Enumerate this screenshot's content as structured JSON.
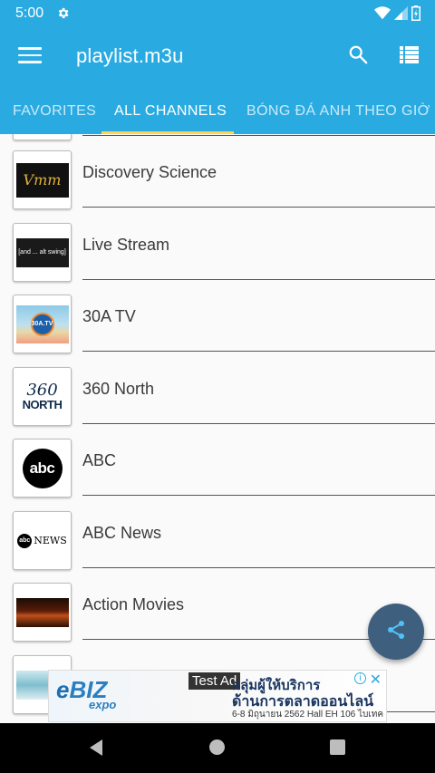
{
  "status_bar": {
    "time": "5:00"
  },
  "app_bar": {
    "title": "playlist.m3u",
    "tabs": [
      {
        "label": "FAVORITES"
      },
      {
        "label": "ALL CHANNELS"
      },
      {
        "label": "BÓNG ĐÁ ANH THEO GIỜ VN"
      }
    ],
    "active_tab": "ALL CHANNELS"
  },
  "channels": [
    {
      "name": "Discovery Science"
    },
    {
      "name": "Live Stream"
    },
    {
      "name": "30A TV"
    },
    {
      "name": "360 North"
    },
    {
      "name": "ABC"
    },
    {
      "name": "ABC News"
    },
    {
      "name": "Action Movies"
    }
  ],
  "thumb_text": {
    "discovery": "Vmm",
    "live": "[and ... alt swing]",
    "tv30": "30A.TV",
    "north360_top": "360",
    "north360_bottom": "NORTH",
    "abc": "abc",
    "abcnews_abc": "abc",
    "abcnews_news": "NEWS"
  },
  "ad": {
    "label": "Test Ad",
    "brand": "BIZ",
    "brand_sub": "expo",
    "line1": "กลุ่มผู้ให้บริการ",
    "line2": "ด้านการตลาดออนไลน์",
    "line3": "6-8 มิถุนายน 2562  Hall EH 106 ไบเทค"
  },
  "colors": {
    "primary": "#29abe2",
    "tab_indicator": "#ffd54f",
    "fab": "#3f5f7f"
  }
}
